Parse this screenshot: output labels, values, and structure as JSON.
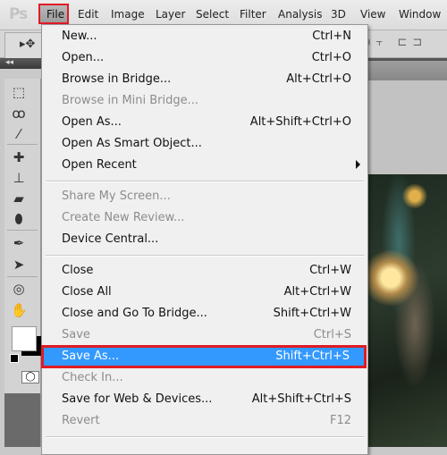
{
  "app": {
    "logo": "Ps"
  },
  "menubar": {
    "items": [
      "File",
      "Edit",
      "Image",
      "Layer",
      "Select",
      "Filter",
      "Analysis",
      "3D",
      "View",
      "Window"
    ]
  },
  "file_menu": {
    "groups": [
      [
        {
          "label": "New...",
          "shortcut": "Ctrl+N",
          "enabled": true
        },
        {
          "label": "Open...",
          "shortcut": "Ctrl+O",
          "enabled": true
        },
        {
          "label": "Browse in Bridge...",
          "shortcut": "Alt+Ctrl+O",
          "enabled": true
        },
        {
          "label": "Browse in Mini Bridge...",
          "shortcut": "",
          "enabled": false
        },
        {
          "label": "Open As...",
          "shortcut": "Alt+Shift+Ctrl+O",
          "enabled": true
        },
        {
          "label": "Open As Smart Object...",
          "shortcut": "",
          "enabled": true
        },
        {
          "label": "Open Recent",
          "shortcut": "",
          "enabled": true,
          "submenu": true
        }
      ],
      [
        {
          "label": "Share My Screen...",
          "shortcut": "",
          "enabled": false
        },
        {
          "label": "Create New Review...",
          "shortcut": "",
          "enabled": false
        },
        {
          "label": "Device Central...",
          "shortcut": "",
          "enabled": true
        }
      ],
      [
        {
          "label": "Close",
          "shortcut": "Ctrl+W",
          "enabled": true
        },
        {
          "label": "Close All",
          "shortcut": "Alt+Ctrl+W",
          "enabled": true
        },
        {
          "label": "Close and Go To Bridge...",
          "shortcut": "Shift+Ctrl+W",
          "enabled": true
        },
        {
          "label": "Save",
          "shortcut": "Ctrl+S",
          "enabled": false
        },
        {
          "label": "Save As...",
          "shortcut": "Shift+Ctrl+S",
          "enabled": true,
          "highlighted": true
        },
        {
          "label": "Check In...",
          "shortcut": "",
          "enabled": false
        },
        {
          "label": "Save for Web & Devices...",
          "shortcut": "Alt+Shift+Ctrl+S",
          "enabled": true
        },
        {
          "label": "Revert",
          "shortcut": "F12",
          "enabled": false
        }
      ]
    ]
  },
  "colors": {
    "highlight": "#3399ff",
    "annotation_box": "#e01b24",
    "menu_bg": "#f0f0f0",
    "disabled_text": "#8c8c8c"
  },
  "toolbox": {
    "tools": [
      "move-tool",
      "marquee-tool",
      "lasso-tool",
      "quick-selection-tool",
      "eyedropper-tool",
      "healing-brush-tool",
      "clone-stamp-tool",
      "eraser-tool",
      "blur-tool",
      "pen-tool",
      "path-selection-tool",
      "3d-rotate-tool",
      "hand-tool"
    ],
    "glyphs": [
      "▸",
      "⬚",
      "ꝏ",
      "✎",
      "⁄",
      "✚",
      "⊥",
      "▰",
      "💧",
      "✒",
      "➤",
      "◎",
      "✋"
    ],
    "quick_mask_glyph": "◯",
    "collapse_glyph": "◂◂"
  }
}
